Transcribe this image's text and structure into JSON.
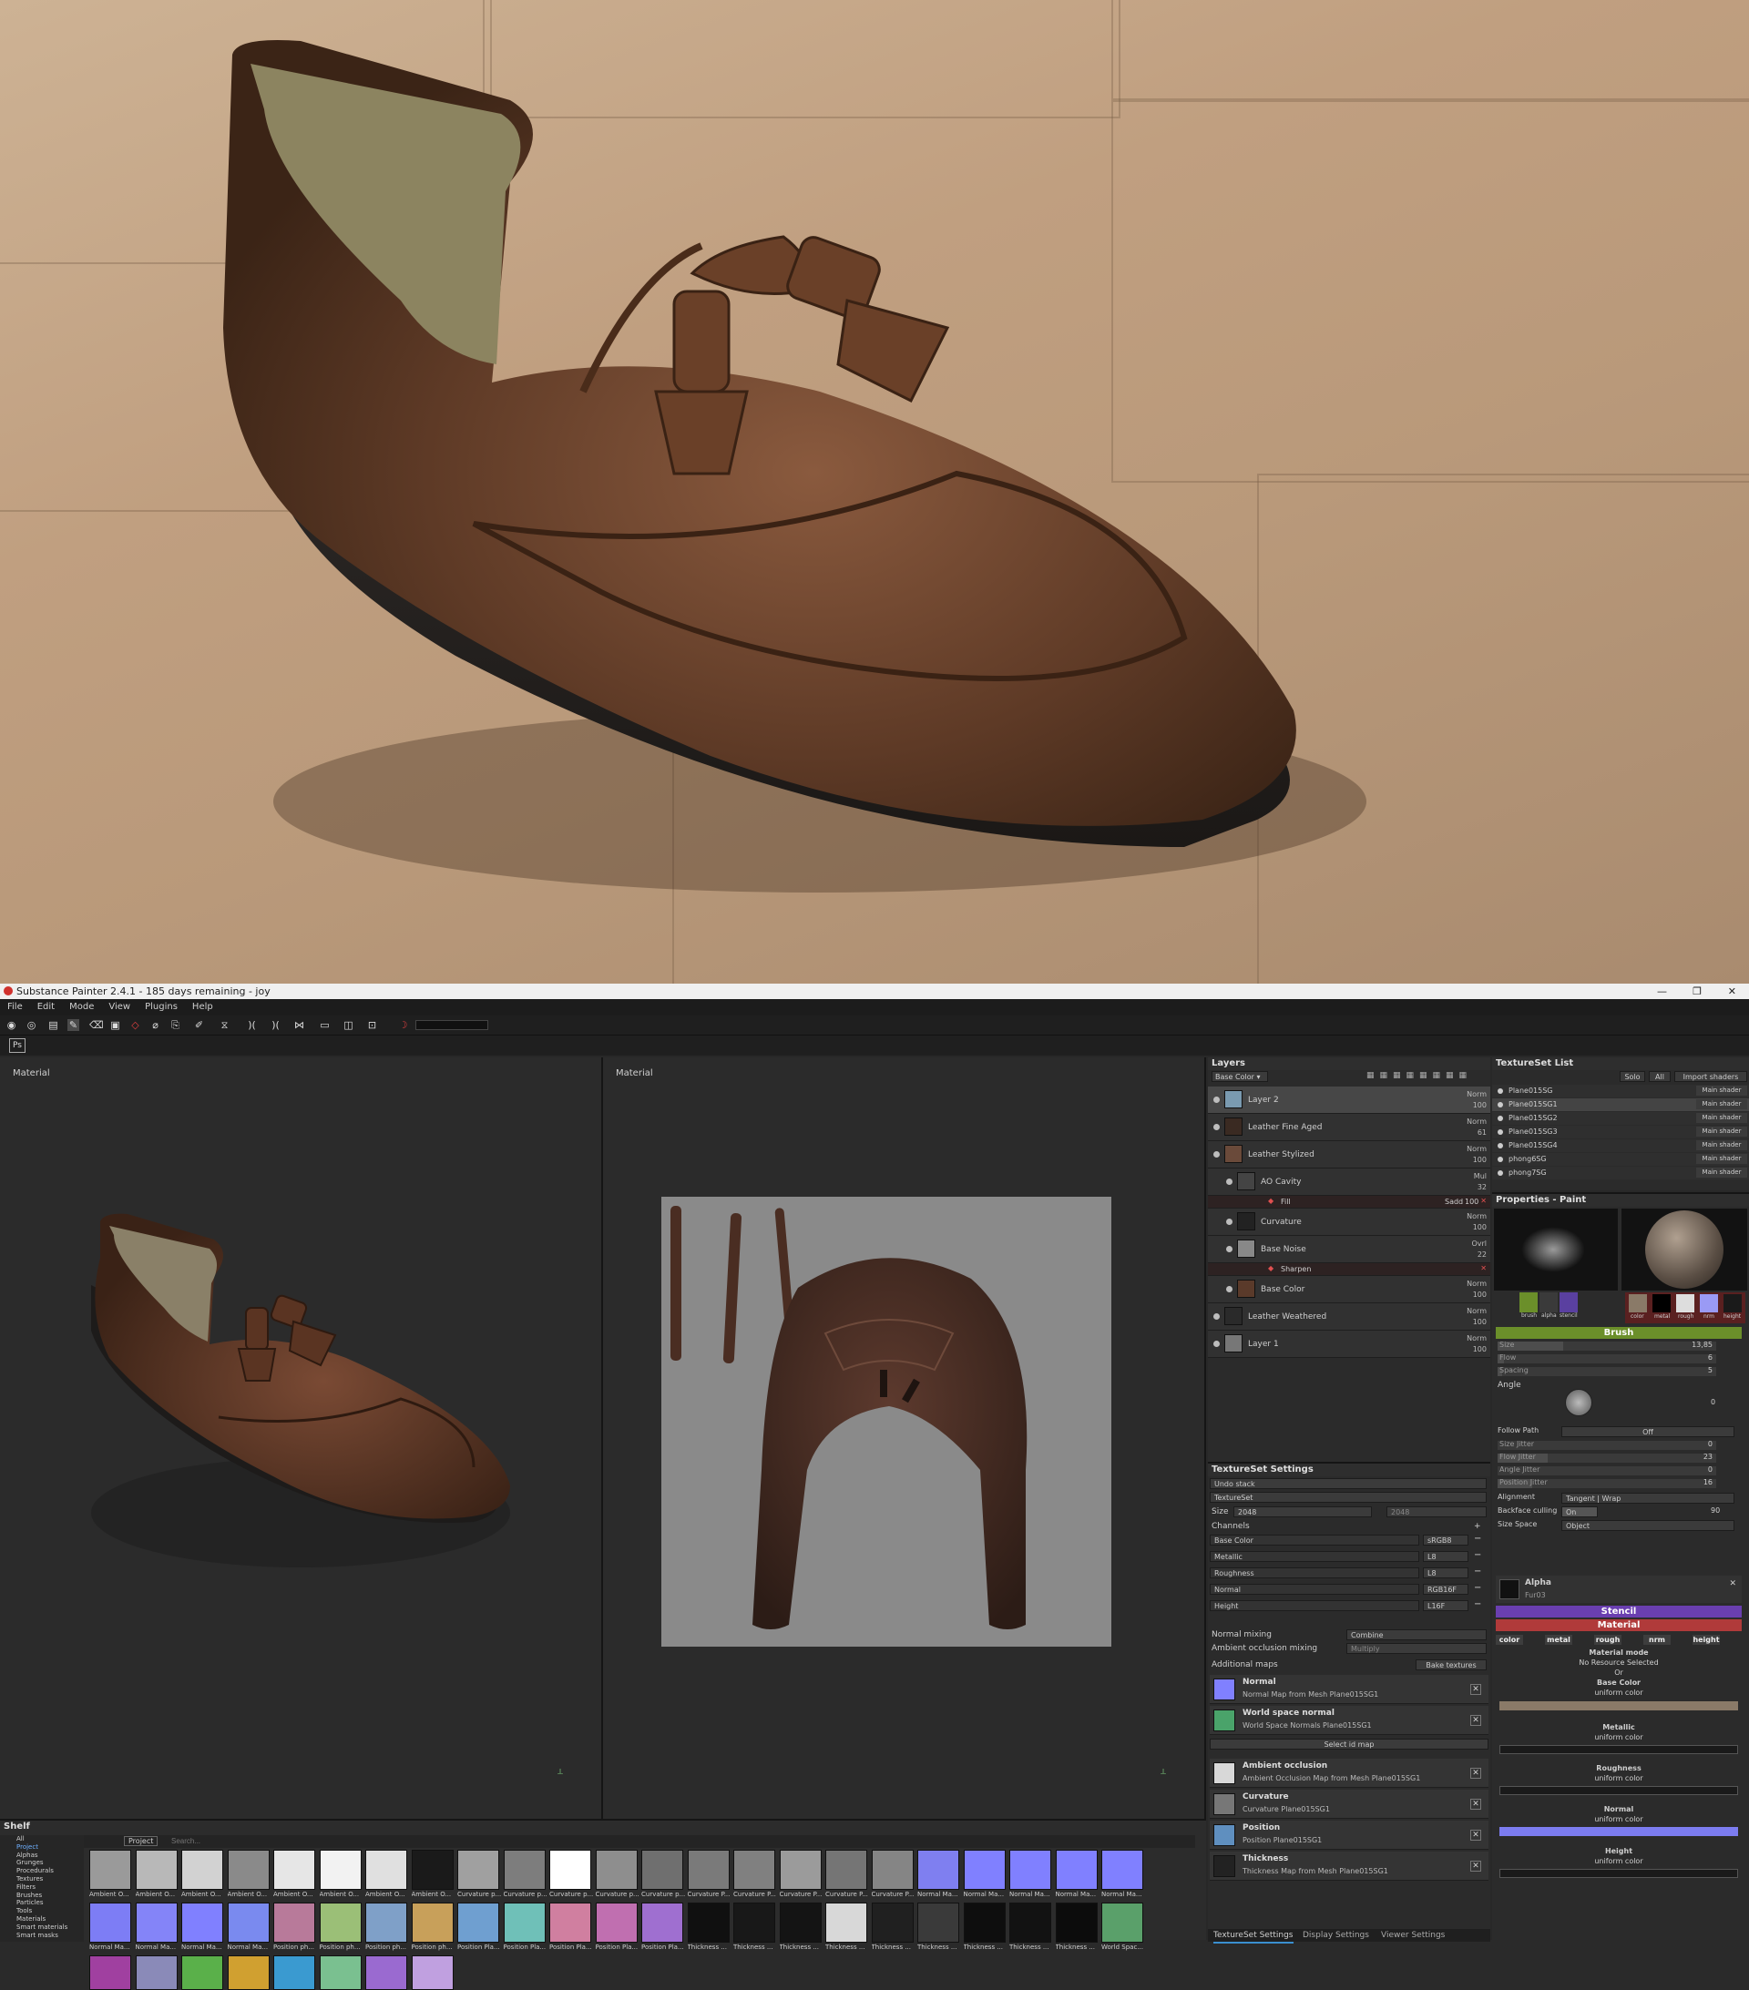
{
  "app": {
    "title": "Substance Painter 2.4.1 - 185 days remaining - joy",
    "menu": [
      "File",
      "Edit",
      "Mode",
      "View",
      "Plugins",
      "Help"
    ],
    "ps_button": "Ps"
  },
  "viewports": {
    "left_label": "Material",
    "right_label": "Material"
  },
  "layers": {
    "title": "Layers",
    "channel_dropdown": "Base Color",
    "items": [
      {
        "name": "Layer 2",
        "blend": "Norm",
        "opacity": "100"
      },
      {
        "name": "Leather Fine Aged",
        "blend": "Norm",
        "opacity": "61"
      },
      {
        "name": "Leather Stylized",
        "blend": "Norm",
        "opacity": "100"
      },
      {
        "name": "AO Cavity",
        "blend": "Mul",
        "opacity": "32"
      },
      {
        "name": "Fill",
        "blend": "Sadd",
        "opacity": "100"
      },
      {
        "name": "Curvature",
        "blend": "Norm",
        "opacity": "100"
      },
      {
        "name": "Base Noise",
        "blend": "Ovrl",
        "opacity": "22"
      },
      {
        "name": "Sharpen",
        "blend": "",
        "opacity": ""
      },
      {
        "name": "Base Color",
        "blend": "Norm",
        "opacity": "100"
      },
      {
        "name": "Leather Weathered",
        "blend": "Norm",
        "opacity": "100"
      },
      {
        "name": "Layer 1",
        "blend": "Norm",
        "opacity": "100"
      }
    ]
  },
  "textureset_settings": {
    "title": "TextureSet Settings",
    "undo_stack": "Undo stack",
    "textureset": "TextureSet",
    "size_label": "Size",
    "size_value": "2048",
    "size_value2": "2048",
    "channels_label": "Channels",
    "channels": [
      {
        "name": "Base Color",
        "format": "sRGB8"
      },
      {
        "name": "Metallic",
        "format": "L8"
      },
      {
        "name": "Roughness",
        "format": "L8"
      },
      {
        "name": "Normal",
        "format": "RGB16F"
      },
      {
        "name": "Height",
        "format": "L16F"
      }
    ],
    "normal_mixing_label": "Normal mixing",
    "normal_mixing_value": "Combine",
    "ao_mixing_label": "Ambient occlusion mixing",
    "ao_mixing_value": "Multiply",
    "additional_maps_label": "Additional maps",
    "bake_button": "Bake textures",
    "select_id_map": "Select id map",
    "maps": [
      {
        "title": "Normal",
        "sub": "Normal Map from Mesh Plane015SG1",
        "color": "#8080ff"
      },
      {
        "title": "World space normal",
        "sub": "World Space Normals Plane015SG1",
        "color": "#4aa36a"
      },
      {
        "title": "Ambient occlusion",
        "sub": "Ambient Occlusion Map from Mesh Plane015SG1",
        "color": "#d8d8d8"
      },
      {
        "title": "Curvature",
        "sub": "Curvature Plane015SG1",
        "color": "#777777"
      },
      {
        "title": "Position",
        "sub": "Position Plane015SG1",
        "color": "#5f8fbf"
      },
      {
        "title": "Thickness",
        "sub": "Thickness Map from Mesh Plane015SG1",
        "color": "#222222"
      }
    ],
    "tabs": [
      "TextureSet Settings",
      "Display Settings",
      "Viewer Settings"
    ]
  },
  "textureset_list": {
    "title": "TextureSet List",
    "buttons": [
      "Solo",
      "All",
      "Import shaders"
    ],
    "items": [
      {
        "name": "Plane015SG",
        "shader": "Main shader"
      },
      {
        "name": "Plane015SG1",
        "shader": "Main shader"
      },
      {
        "name": "Plane015SG2",
        "shader": "Main shader"
      },
      {
        "name": "Plane015SG3",
        "shader": "Main shader"
      },
      {
        "name": "Plane015SG4",
        "shader": "Main shader"
      },
      {
        "name": "phong6SG",
        "shader": "Main shader"
      },
      {
        "name": "phong7SG",
        "shader": "Main shader"
      }
    ]
  },
  "properties": {
    "title": "Properties - Paint",
    "brush_tabs": [
      "brush",
      "alpha",
      "stencil"
    ],
    "mat_tabs": [
      "color",
      "metal",
      "rough",
      "nrm",
      "height"
    ],
    "brush_section": "Brush",
    "size_label": "Size",
    "size_value": "13,85",
    "flow_label": "Flow",
    "flow_value": "6",
    "spacing_label": "Spacing",
    "spacing_value": "5",
    "angle_label": "Angle",
    "angle_value": "0",
    "follow_path_label": "Follow Path",
    "follow_path_value": "Off",
    "size_jitter_label": "Size Jitter",
    "size_jitter_value": "0",
    "flow_jitter_label": "Flow Jitter",
    "flow_jitter_value": "23",
    "angle_jitter_label": "Angle Jitter",
    "angle_jitter_value": "0",
    "position_jitter_label": "Position Jitter",
    "position_jitter_value": "16",
    "alignment_label": "Alignment",
    "alignment_value": "Tangent | Wrap",
    "backface_label": "Backface culling",
    "backface_value": "On",
    "backface_num": "90",
    "size_space_label": "Size Space",
    "size_space_value": "Object",
    "alpha_label": "Alpha",
    "alpha_value": "Fur03",
    "stencil_section": "Stencil",
    "material_section": "Material",
    "channel_buttons": [
      "color",
      "metal",
      "rough",
      "nrm",
      "height"
    ],
    "material_mode_label": "Material mode",
    "material_mode_value": "No Resource Selected",
    "or_label": "Or",
    "base_color_label": "Base Color",
    "base_color_sub": "uniform color",
    "metallic_label": "Metallic",
    "metallic_sub": "uniform color",
    "roughness_label": "Roughness",
    "roughness_sub": "uniform color",
    "normal_label": "Normal",
    "normal_sub": "uniform color",
    "height_label": "Height",
    "height_sub": "uniform color",
    "colors": {
      "brush_bar": "#6b8f2a",
      "stencil_bar": "#6a3fb0",
      "material_bar": "#b03a3a",
      "base_color_swatch": "#8a7a68",
      "normal_swatch": "#7c7cf0"
    }
  },
  "shelf": {
    "title": "Shelf",
    "categories": [
      "All",
      "Project",
      "Alphas",
      "Grunges",
      "Procedurals",
      "Textures",
      "Filters",
      "Brushes",
      "Particles",
      "Tools",
      "Materials",
      "Smart materials",
      "Smart masks"
    ],
    "filter_tag": "Project",
    "search_placeholder": "Search...",
    "row1": [
      {
        "label": "Ambient O...",
        "color": "#9a9a9a"
      },
      {
        "label": "Ambient O...",
        "color": "#b8b8b8"
      },
      {
        "label": "Ambient O...",
        "color": "#d2d2d2"
      },
      {
        "label": "Ambient O...",
        "color": "#8a8a8a"
      },
      {
        "label": "Ambient O...",
        "color": "#e6e6e6"
      },
      {
        "label": "Ambient O...",
        "color": "#f2f2f2"
      },
      {
        "label": "Ambient O...",
        "color": "#e0e0e0"
      },
      {
        "label": "Ambient O...",
        "color": "#1a1a1a"
      },
      {
        "label": "Curvature p...",
        "color": "#a0a0a0"
      },
      {
        "label": "Curvature p...",
        "color": "#7d7d7d"
      },
      {
        "label": "Curvature p...",
        "color": "#ffffff"
      },
      {
        "label": "Curvature p...",
        "color": "#8e8e8e"
      },
      {
        "label": "Curvature p...",
        "color": "#6f6f6f"
      },
      {
        "label": "Curvature P...",
        "color": "#7a7a7a"
      },
      {
        "label": "Curvature P...",
        "color": "#808080"
      },
      {
        "label": "Curvature P...",
        "color": "#9b9b9b"
      },
      {
        "label": "Curvature P...",
        "color": "#757575"
      },
      {
        "label": "Curvature P...",
        "color": "#858585"
      },
      {
        "label": "Normal Ma...",
        "color": "#7f7ff0"
      },
      {
        "label": "Normal Ma...",
        "color": "#8080ff"
      },
      {
        "label": "Normal Ma...",
        "color": "#8080ff"
      },
      {
        "label": "Normal Ma...",
        "color": "#8080ff"
      },
      {
        "label": "Normal Ma...",
        "color": "#8080ff"
      }
    ],
    "row2": [
      {
        "label": "Normal Ma...",
        "color": "#7d7df5"
      },
      {
        "label": "Normal Ma...",
        "color": "#8484f8"
      },
      {
        "label": "Normal Ma...",
        "color": "#8080ff"
      },
      {
        "label": "Normal Ma...",
        "color": "#7a8aef"
      },
      {
        "label": "Position ph...",
        "color": "#b87a9a"
      },
      {
        "label": "Position ph...",
        "color": "#9bbf77"
      },
      {
        "label": "Position ph...",
        "color": "#7fa0c8"
      },
      {
        "label": "Position ph...",
        "color": "#c8a05a"
      },
      {
        "label": "Position Pla...",
        "color": "#6f9fd0"
      },
      {
        "label": "Position Pla...",
        "color": "#6fc0b8"
      },
      {
        "label": "Position Pla...",
        "color": "#d07fa0"
      },
      {
        "label": "Position Pla...",
        "color": "#c06fb0"
      },
      {
        "label": "Position Pla...",
        "color": "#9f6fd0"
      },
      {
        "label": "Thickness ...",
        "color": "#101010"
      },
      {
        "label": "Thickness ...",
        "color": "#181818"
      },
      {
        "label": "Thickness ...",
        "color": "#141414"
      },
      {
        "label": "Thickness ...",
        "color": "#d8d8d8"
      },
      {
        "label": "Thickness ...",
        "color": "#202020"
      },
      {
        "label": "Thickness ...",
        "color": "#3a3a3a"
      },
      {
        "label": "Thickness ...",
        "color": "#0e0e0e"
      },
      {
        "label": "Thickness ...",
        "color": "#121212"
      },
      {
        "label": "Thickness ...",
        "color": "#0c0c0c"
      },
      {
        "label": "World Spac...",
        "color": "#5aa06a"
      }
    ],
    "row3": [
      {
        "label": "",
        "color": "#a040a0"
      },
      {
        "label": "",
        "color": "#8a8ab8"
      },
      {
        "label": "",
        "color": "#5ab04a"
      },
      {
        "label": "",
        "color": "#d0a030"
      },
      {
        "label": "",
        "color": "#3a9ad0"
      },
      {
        "label": "",
        "color": "#7ac090"
      },
      {
        "label": "",
        "color": "#9a6ad0"
      },
      {
        "label": "",
        "color": "#c0a0e0"
      }
    ]
  }
}
